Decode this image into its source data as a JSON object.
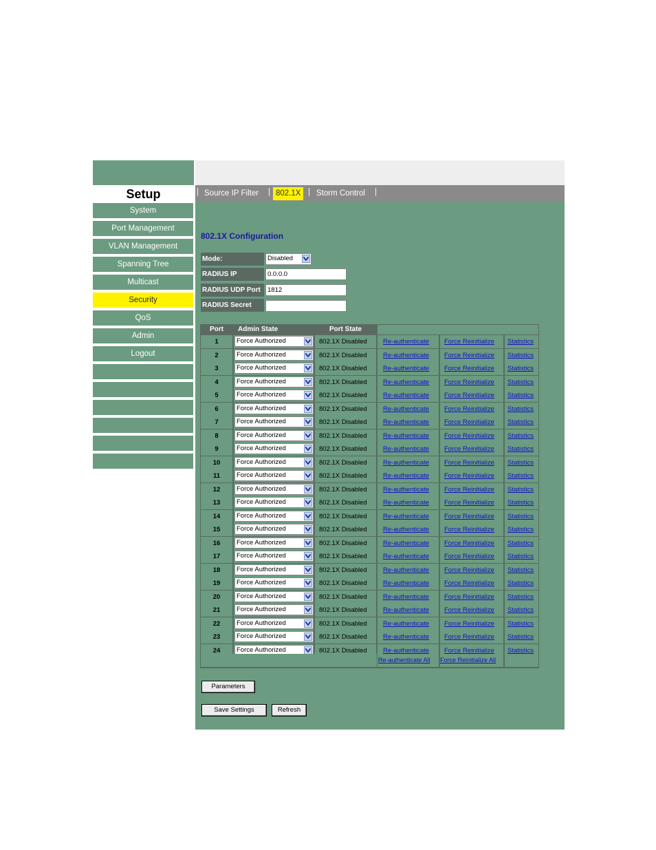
{
  "sidebar": {
    "title": "Setup",
    "items": [
      {
        "label": "System",
        "active": false
      },
      {
        "label": "Port Management",
        "active": false
      },
      {
        "label": "VLAN Management",
        "active": false
      },
      {
        "label": "Spanning Tree",
        "active": false
      },
      {
        "label": "Multicast",
        "active": false
      },
      {
        "label": "Security",
        "active": true
      },
      {
        "label": "QoS",
        "active": false
      },
      {
        "label": "Admin",
        "active": false
      },
      {
        "label": "Logout",
        "active": false
      },
      {
        "label": "",
        "active": false
      },
      {
        "label": "",
        "active": false
      },
      {
        "label": "",
        "active": false
      },
      {
        "label": "",
        "active": false
      },
      {
        "label": "",
        "active": false
      },
      {
        "label": "",
        "active": false
      }
    ]
  },
  "tabs": [
    {
      "label": "Source IP Filter",
      "active": false
    },
    {
      "label": "802.1X",
      "active": true
    },
    {
      "label": "Storm Control",
      "active": false
    }
  ],
  "config": {
    "title": "802.1X Configuration",
    "mode_label": "Mode:",
    "mode_value": "Disabled",
    "radius_ip_label": "RADIUS IP",
    "radius_ip_value": "0.0.0.0",
    "radius_port_label": "RADIUS UDP Port",
    "radius_port_value": "1812",
    "radius_secret_label": "RADIUS Secret",
    "radius_secret_value": ""
  },
  "table": {
    "headers": {
      "port": "Port",
      "admin_state": "Admin State",
      "port_state": "Port State"
    },
    "link_labels": {
      "reauth": "Re-authenticate",
      "force": "Force Reinitialize",
      "stats": "Statistics"
    },
    "rows": [
      {
        "port": "1",
        "admin_state": "Force Authorized",
        "port_state": "802.1X Disabled"
      },
      {
        "port": "2",
        "admin_state": "Force Authorized",
        "port_state": "802.1X Disabled"
      },
      {
        "port": "3",
        "admin_state": "Force Authorized",
        "port_state": "802.1X Disabled"
      },
      {
        "port": "4",
        "admin_state": "Force Authorized",
        "port_state": "802.1X Disabled"
      },
      {
        "port": "5",
        "admin_state": "Force Authorized",
        "port_state": "802.1X Disabled"
      },
      {
        "port": "6",
        "admin_state": "Force Authorized",
        "port_state": "802.1X Disabled"
      },
      {
        "port": "7",
        "admin_state": "Force Authorized",
        "port_state": "802.1X Disabled"
      },
      {
        "port": "8",
        "admin_state": "Force Authorized",
        "port_state": "802.1X Disabled"
      },
      {
        "port": "9",
        "admin_state": "Force Authorized",
        "port_state": "802.1X Disabled"
      },
      {
        "port": "10",
        "admin_state": "Force Authorized",
        "port_state": "802.1X Disabled"
      },
      {
        "port": "11",
        "admin_state": "Force Authorized",
        "port_state": "802.1X Disabled"
      },
      {
        "port": "12",
        "admin_state": "Force Authorized",
        "port_state": "802.1X Disabled"
      },
      {
        "port": "13",
        "admin_state": "Force Authorized",
        "port_state": "802.1X Disabled"
      },
      {
        "port": "14",
        "admin_state": "Force Authorized",
        "port_state": "802.1X Disabled"
      },
      {
        "port": "15",
        "admin_state": "Force Authorized",
        "port_state": "802.1X Disabled"
      },
      {
        "port": "16",
        "admin_state": "Force Authorized",
        "port_state": "802.1X Disabled"
      },
      {
        "port": "17",
        "admin_state": "Force Authorized",
        "port_state": "802.1X Disabled"
      },
      {
        "port": "18",
        "admin_state": "Force Authorized",
        "port_state": "802.1X Disabled"
      },
      {
        "port": "19",
        "admin_state": "Force Authorized",
        "port_state": "802.1X Disabled"
      },
      {
        "port": "20",
        "admin_state": "Force Authorized",
        "port_state": "802.1X Disabled"
      },
      {
        "port": "21",
        "admin_state": "Force Authorized",
        "port_state": "802.1X Disabled"
      },
      {
        "port": "22",
        "admin_state": "Force Authorized",
        "port_state": "802.1X Disabled"
      },
      {
        "port": "23",
        "admin_state": "Force Authorized",
        "port_state": "802.1X Disabled"
      },
      {
        "port": "24",
        "admin_state": "Force Authorized",
        "port_state": "802.1X Disabled"
      }
    ],
    "footer": {
      "reauth_all": "Re-authenticate All",
      "force_all": "Force Reinitialize All"
    }
  },
  "buttons": {
    "parameters": "Parameters",
    "save": "Save Settings",
    "refresh": "Refresh"
  },
  "colors": {
    "panel": "#6b9b80",
    "header_cell": "#5a6a62",
    "highlight": "#fff200",
    "tabbar": "#8a8a8a",
    "link": "#1010c8"
  }
}
